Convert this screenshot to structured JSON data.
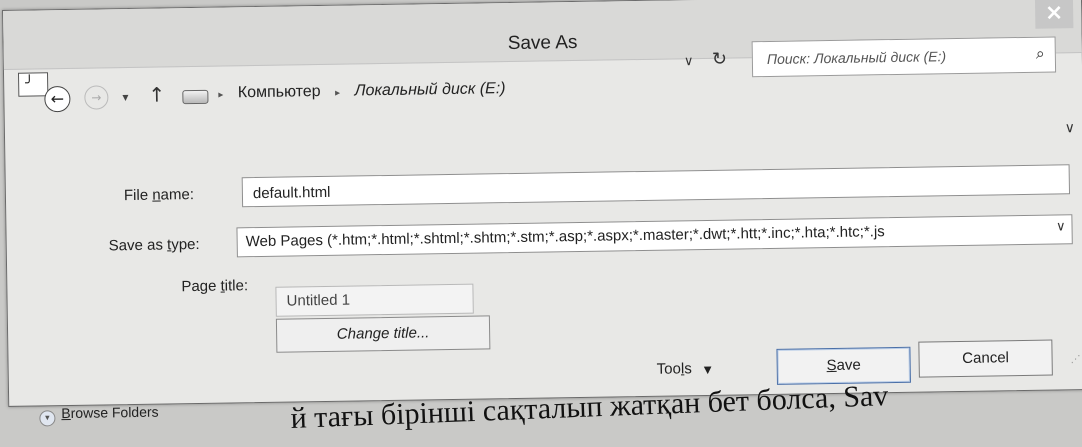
{
  "window": {
    "title": "Save As",
    "close_glyph": "×",
    "app_icon": "document-icon"
  },
  "nav": {
    "back_glyph": "←",
    "forward_glyph": "→",
    "recent_glyph": "▾",
    "up_glyph": "↑",
    "drive_icon": "drive-icon",
    "breadcrumb": [
      "Компьютер",
      "Локальный диск (E:)"
    ],
    "sep_glyph": "▸",
    "dropdown_glyph": "∨",
    "refresh_glyph": "↻"
  },
  "search": {
    "placeholder": "Поиск: Локальный диск (E:)",
    "icon_glyph": "⌕"
  },
  "form": {
    "file_name_label_pre": "File ",
    "file_name_label_u": "n",
    "file_name_label_post": "ame:",
    "file_name_value": "default.html",
    "save_type_label_pre": "Save as ",
    "save_type_label_u": "t",
    "save_type_label_post": "ype:",
    "save_type_value": "Web Pages (*.htm;*.html;*.shtml;*.shtm;*.stm;*.asp;*.aspx;*.master;*.dwt;*.htt;*.inc;*.hta;*.htc;*.js",
    "page_title_label_pre": "Page ",
    "page_title_label_u": "t",
    "page_title_label_post": "itle:",
    "page_title_value": "Untitled 1",
    "change_title_label": "Change title..."
  },
  "footer": {
    "tools_pre": "Too",
    "tools_u": "l",
    "tools_post": "s",
    "tools_arrow": "▼",
    "save_u": "S",
    "save_post": "ave",
    "cancel_label": "Cancel",
    "browse_u": "B",
    "browse_post": "rowse Folders",
    "browse_glyph": "▾"
  },
  "caption": {
    "text": "й тағы бірінші сақталып жатқан бет болса, Sav"
  },
  "colors": {
    "dialog_bg": "#e8e8e6",
    "titlebar_bg": "#d9d9d7",
    "close_bg": "#c7c7c7",
    "save_focus": "#4a6fa7"
  }
}
